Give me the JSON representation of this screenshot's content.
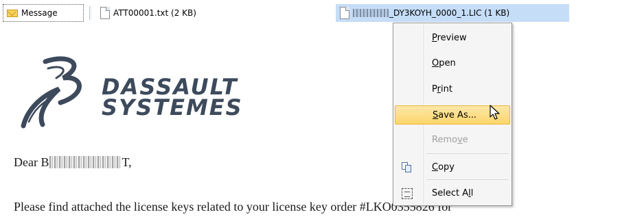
{
  "attachments": {
    "message_label": "Message",
    "txt_label": "ATT00001.txt (2 KB)",
    "lic_label": "_DY3KOYH_0000_1.LIC (1 KB)"
  },
  "logo": {
    "line1": "DASSAULT",
    "line2": "SYSTEMES"
  },
  "letter": {
    "greeting_prefix": "Dear B",
    "greeting_suffix": "T,",
    "body_line": "Please find attached the license keys related to your license key order #LKO0355826 for"
  },
  "context_menu": {
    "preview_pre": "",
    "preview_ul": "P",
    "preview_post": "review",
    "open_pre": "",
    "open_ul": "O",
    "open_post": "pen",
    "print_pre": "P",
    "print_ul": "r",
    "print_post": "int",
    "saveas_pre": "",
    "saveas_ul": "S",
    "saveas_post": "ave As...",
    "remove_pre": "Remo",
    "remove_ul": "v",
    "remove_post": "e",
    "copy_pre": "",
    "copy_ul": "C",
    "copy_post": "opy",
    "selectall_pre": "Select A",
    "selectall_ul": "l",
    "selectall_post": "l"
  },
  "colors": {
    "selected_attachment_bg": "#c5ddf7",
    "menu_hover_bg": "#fbd66b",
    "logo_color": "#3d4a5c"
  }
}
